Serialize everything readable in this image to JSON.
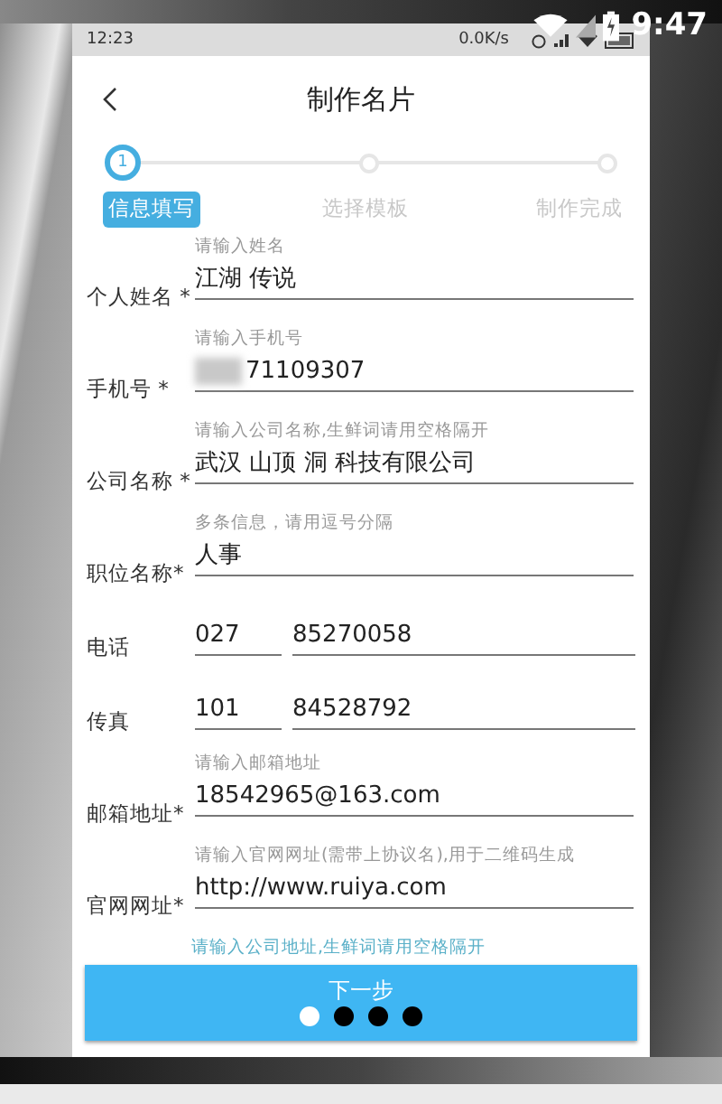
{
  "outer_status": {
    "time": "9:47"
  },
  "status_bar": {
    "time": "12:23",
    "speed": "0.0K/s"
  },
  "header": {
    "title": "制作名片"
  },
  "steps": [
    {
      "number": "1",
      "label": "信息填写",
      "selected": true
    },
    {
      "label": "选择模板",
      "selected": false
    },
    {
      "label": "制作完成",
      "selected": false
    }
  ],
  "fields": [
    {
      "kind": "single",
      "label": "个人姓名 *",
      "hint": "请输入姓名",
      "value": "江湖 传说"
    },
    {
      "kind": "single",
      "label": "手机号 *",
      "hint": "请输入手机号",
      "value": "71109307",
      "blurred": true
    },
    {
      "kind": "single",
      "label": "公司名称 *",
      "hint": "请输入公司名称,生鲜词请用空格隔开",
      "value": "武汉 山顶 洞 科技有限公司"
    },
    {
      "kind": "single",
      "label": "职位名称*",
      "hint": "多条信息，请用逗号分隔",
      "value": "人事"
    },
    {
      "kind": "pair",
      "label": "电话",
      "values": [
        "027",
        "85270058"
      ]
    },
    {
      "kind": "pair",
      "label": "传真",
      "values": [
        "101",
        "84528792"
      ]
    },
    {
      "kind": "single",
      "label": "邮箱地址*",
      "hint": "请输入邮箱地址",
      "value": "18542965@163.com"
    },
    {
      "kind": "single",
      "label": "官网网址*",
      "hint": "请输入官网网址(需带上协议名),用于二维码生成",
      "value": "http://www.ruiya.com"
    }
  ],
  "cut_hint": "请输入公司地址,生鲜词请用空格隔开",
  "next_button": "下一步",
  "page_dots": [
    {
      "selected": true
    },
    {
      "selected": false
    },
    {
      "selected": false
    },
    {
      "selected": false
    }
  ]
}
